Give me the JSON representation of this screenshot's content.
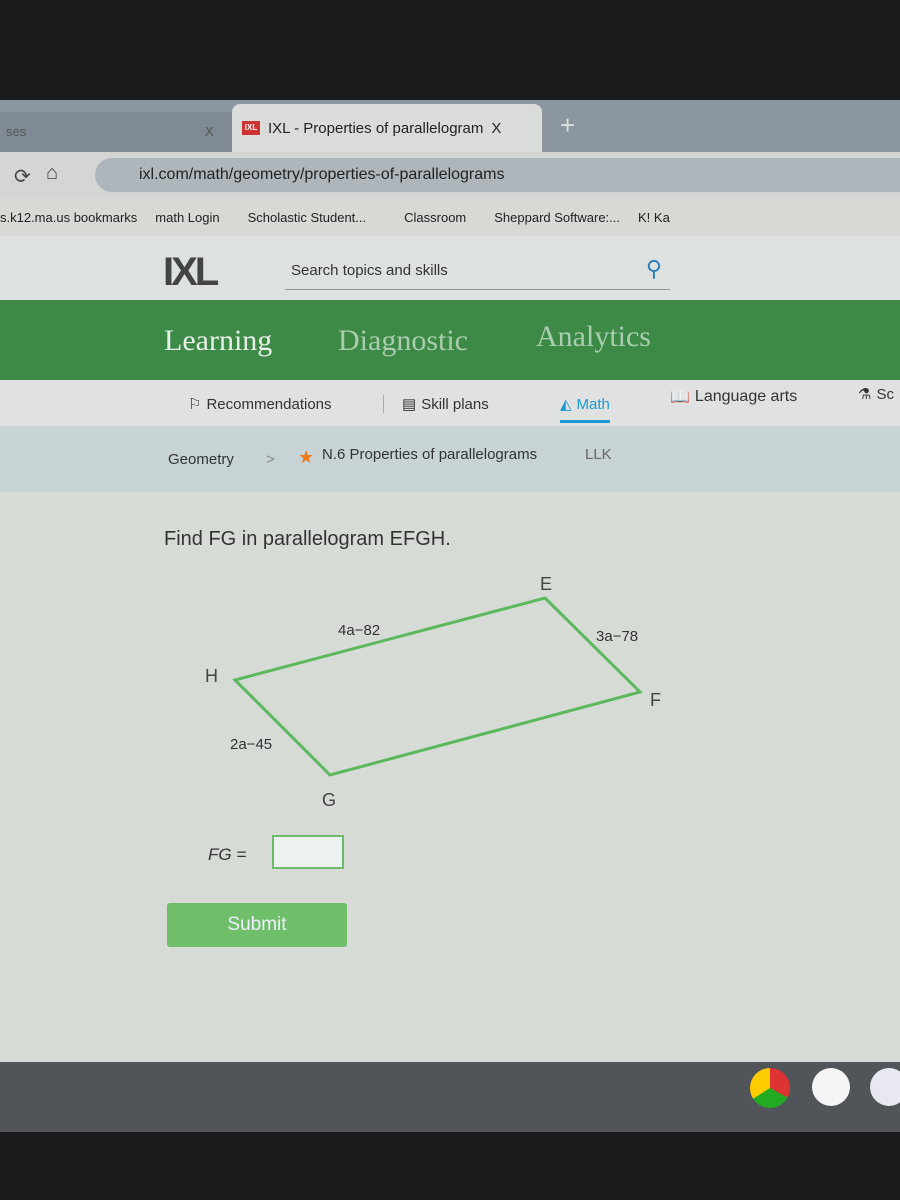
{
  "browser": {
    "inactive_tab": "ses",
    "active_tab": "IXL - Properties of parallelogram",
    "tab_close": "X",
    "new_tab": "+",
    "url": "ixl.com/math/geometry/properties-of-parallelograms",
    "bookmarks": [
      "s.k12.ma.us bookmarks",
      "math Login",
      "Scholastic Student...",
      "Classroom",
      "Sheppard Software:...",
      "K! Ka"
    ]
  },
  "header": {
    "logo": "IXL",
    "search_placeholder": "Search topics and skills"
  },
  "nav": {
    "items": [
      "Learning",
      "Diagnostic",
      "Analytics"
    ]
  },
  "subnav": {
    "items": [
      "Recommendations",
      "Skill plans",
      "Math",
      "Language arts",
      "Sc"
    ],
    "active": "Math",
    "accent": "#1a9ad6"
  },
  "breadcrumb": {
    "parent": "Geometry",
    "separator": ">",
    "skill": "N.6 Properties of parallelograms",
    "code": "LLK"
  },
  "question": {
    "prompt": "Find FG in parallelogram EFGH.",
    "vertices": {
      "E": "E",
      "F": "F",
      "G": "G",
      "H": "H"
    },
    "sides": {
      "EH": "4a−82",
      "EF": "3a−78",
      "HG": "2a−45"
    },
    "answer_label": "FG =",
    "answer_value": "",
    "submit": "Submit",
    "shape_color": "#5cb85c"
  }
}
